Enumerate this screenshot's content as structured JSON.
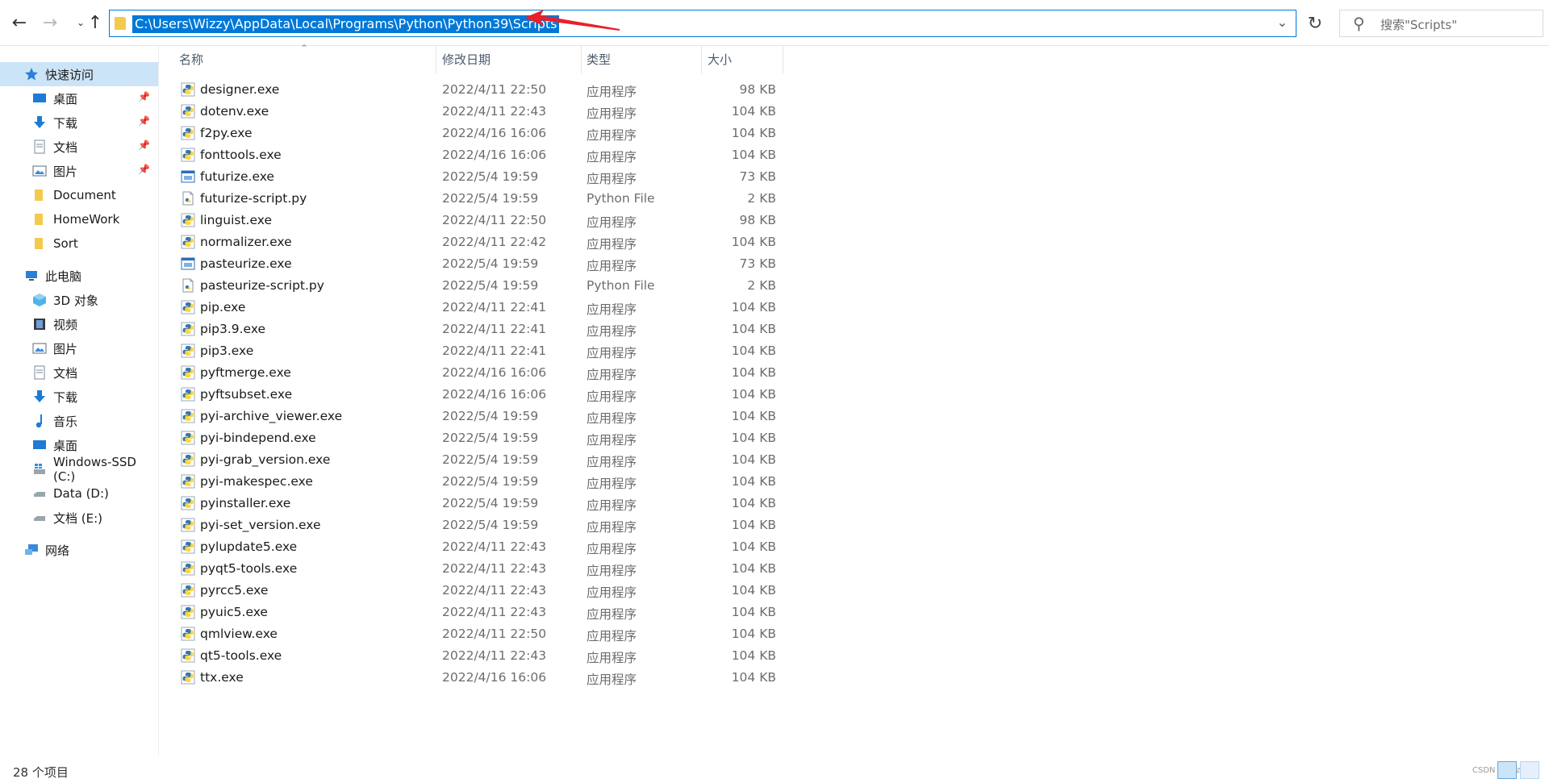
{
  "address_bar": {
    "path": "C:\\Users\\Wizzy\\AppData\\Local\\Programs\\Python\\Python39\\Scripts"
  },
  "search": {
    "placeholder": "搜索\"Scripts\""
  },
  "columns": {
    "name": "名称",
    "date": "修改日期",
    "type": "类型",
    "size": "大小"
  },
  "sidebar": {
    "quick_access": "快速访问",
    "quick_items": [
      "桌面",
      "下载",
      "文档",
      "图片",
      "Document",
      "HomeWork",
      "Sort"
    ],
    "this_pc": "此电脑",
    "pc_items": [
      "3D 对象",
      "视频",
      "图片",
      "文档",
      "下载",
      "音乐",
      "桌面",
      "Windows-SSD (C:)",
      "Data (D:)",
      "文档 (E:)"
    ],
    "network": "网络"
  },
  "files": [
    {
      "name": "designer.exe",
      "date": "2022/4/11 22:50",
      "type": "应用程序",
      "size": "98 KB",
      "icon": "python-exe-icon"
    },
    {
      "name": "dotenv.exe",
      "date": "2022/4/11 22:43",
      "type": "应用程序",
      "size": "104 KB",
      "icon": "python-exe-icon"
    },
    {
      "name": "f2py.exe",
      "date": "2022/4/16 16:06",
      "type": "应用程序",
      "size": "104 KB",
      "icon": "python-exe-icon"
    },
    {
      "name": "fonttools.exe",
      "date": "2022/4/16 16:06",
      "type": "应用程序",
      "size": "104 KB",
      "icon": "python-exe-icon"
    },
    {
      "name": "futurize.exe",
      "date": "2022/5/4 19:59",
      "type": "应用程序",
      "size": "73 KB",
      "icon": "window-exe-icon"
    },
    {
      "name": "futurize-script.py",
      "date": "2022/5/4 19:59",
      "type": "Python File",
      "size": "2 KB",
      "icon": "python-file-icon"
    },
    {
      "name": "linguist.exe",
      "date": "2022/4/11 22:50",
      "type": "应用程序",
      "size": "98 KB",
      "icon": "python-exe-icon"
    },
    {
      "name": "normalizer.exe",
      "date": "2022/4/11 22:42",
      "type": "应用程序",
      "size": "104 KB",
      "icon": "python-exe-icon"
    },
    {
      "name": "pasteurize.exe",
      "date": "2022/5/4 19:59",
      "type": "应用程序",
      "size": "73 KB",
      "icon": "window-exe-icon"
    },
    {
      "name": "pasteurize-script.py",
      "date": "2022/5/4 19:59",
      "type": "Python File",
      "size": "2 KB",
      "icon": "python-file-icon"
    },
    {
      "name": "pip.exe",
      "date": "2022/4/11 22:41",
      "type": "应用程序",
      "size": "104 KB",
      "icon": "python-exe-icon"
    },
    {
      "name": "pip3.9.exe",
      "date": "2022/4/11 22:41",
      "type": "应用程序",
      "size": "104 KB",
      "icon": "python-exe-icon"
    },
    {
      "name": "pip3.exe",
      "date": "2022/4/11 22:41",
      "type": "应用程序",
      "size": "104 KB",
      "icon": "python-exe-icon"
    },
    {
      "name": "pyftmerge.exe",
      "date": "2022/4/16 16:06",
      "type": "应用程序",
      "size": "104 KB",
      "icon": "python-exe-icon"
    },
    {
      "name": "pyftsubset.exe",
      "date": "2022/4/16 16:06",
      "type": "应用程序",
      "size": "104 KB",
      "icon": "python-exe-icon"
    },
    {
      "name": "pyi-archive_viewer.exe",
      "date": "2022/5/4 19:59",
      "type": "应用程序",
      "size": "104 KB",
      "icon": "python-exe-icon"
    },
    {
      "name": "pyi-bindepend.exe",
      "date": "2022/5/4 19:59",
      "type": "应用程序",
      "size": "104 KB",
      "icon": "python-exe-icon"
    },
    {
      "name": "pyi-grab_version.exe",
      "date": "2022/5/4 19:59",
      "type": "应用程序",
      "size": "104 KB",
      "icon": "python-exe-icon"
    },
    {
      "name": "pyi-makespec.exe",
      "date": "2022/5/4 19:59",
      "type": "应用程序",
      "size": "104 KB",
      "icon": "python-exe-icon"
    },
    {
      "name": "pyinstaller.exe",
      "date": "2022/5/4 19:59",
      "type": "应用程序",
      "size": "104 KB",
      "icon": "python-exe-icon"
    },
    {
      "name": "pyi-set_version.exe",
      "date": "2022/5/4 19:59",
      "type": "应用程序",
      "size": "104 KB",
      "icon": "python-exe-icon"
    },
    {
      "name": "pylupdate5.exe",
      "date": "2022/4/11 22:43",
      "type": "应用程序",
      "size": "104 KB",
      "icon": "python-exe-icon"
    },
    {
      "name": "pyqt5-tools.exe",
      "date": "2022/4/11 22:43",
      "type": "应用程序",
      "size": "104 KB",
      "icon": "python-exe-icon"
    },
    {
      "name": "pyrcc5.exe",
      "date": "2022/4/11 22:43",
      "type": "应用程序",
      "size": "104 KB",
      "icon": "python-exe-icon"
    },
    {
      "name": "pyuic5.exe",
      "date": "2022/4/11 22:43",
      "type": "应用程序",
      "size": "104 KB",
      "icon": "python-exe-icon"
    },
    {
      "name": "qmlview.exe",
      "date": "2022/4/11 22:50",
      "type": "应用程序",
      "size": "104 KB",
      "icon": "python-exe-icon"
    },
    {
      "name": "qt5-tools.exe",
      "date": "2022/4/11 22:43",
      "type": "应用程序",
      "size": "104 KB",
      "icon": "python-exe-icon"
    },
    {
      "name": "ttx.exe",
      "date": "2022/4/16 16:06",
      "type": "应用程序",
      "size": "104 KB",
      "icon": "python-exe-icon"
    }
  ],
  "status": {
    "item_count": "28 个项目"
  },
  "watermark": "CSDN @Wizzy",
  "colors": {
    "accent": "#0078d7",
    "selection": "#cce4f7",
    "folder": "#f4c94d",
    "annotation_arrow": "#e8202a"
  }
}
